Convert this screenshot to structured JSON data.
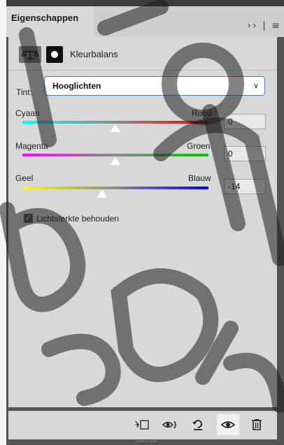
{
  "panel": {
    "tab_title": "Eigenschappen",
    "tab_icons": "›› | ≡",
    "adjustment_title": "Kleurbalans"
  },
  "tint": {
    "label": "Tint:",
    "value": "Hooglichten"
  },
  "sliders": [
    {
      "left": "Cyaan",
      "right": "Rood",
      "value": "0",
      "level": 0,
      "left_color": "#00ffff",
      "right_color": "#ff0000"
    },
    {
      "left": "Magenta",
      "right": "Groen",
      "value": "0",
      "level": 0,
      "left_color": "#ff00ff",
      "right_color": "#00c800"
    },
    {
      "left": "Geel",
      "right": "Blauw",
      "value": "-14",
      "level": -14,
      "left_color": "#ffff00",
      "right_color": "#0000ff"
    }
  ],
  "preserve_luminosity": {
    "label": "Lichtsterkte behouden",
    "checked": true
  },
  "footer_icons": [
    "clip-to-layer-icon",
    "view-previous-icon",
    "reset-icon",
    "visibility-icon",
    "trash-icon"
  ]
}
